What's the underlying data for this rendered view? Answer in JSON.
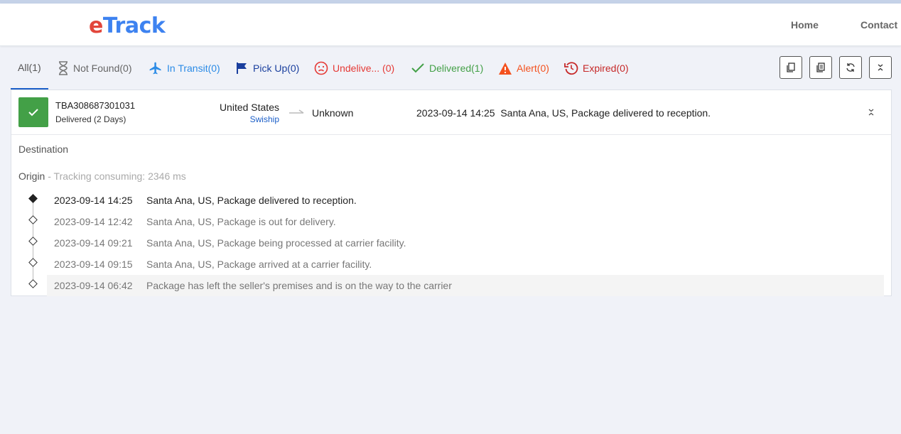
{
  "app": {
    "logo_e": "e",
    "logo_rest": "Track"
  },
  "nav": {
    "home": "Home",
    "contact": "Contact"
  },
  "tabs": [
    {
      "label": "All(1)",
      "icon": "none",
      "color": "#555555"
    },
    {
      "label": "Not Found(0)",
      "icon": "hourglass-icon",
      "color": "#666666"
    },
    {
      "label": "In Transit(0)",
      "icon": "airplane-icon",
      "color": "#2b8be6"
    },
    {
      "label": "Pick Up(0)",
      "icon": "flag-icon",
      "color": "#1a3f9e"
    },
    {
      "label": "Undelive... (0)",
      "icon": "sad-face-icon",
      "color": "#e53935"
    },
    {
      "label": "Delivered(1)",
      "icon": "check-icon",
      "color": "#43a047"
    },
    {
      "label": "Alert(0)",
      "icon": "warning-icon",
      "color": "#f4511e"
    },
    {
      "label": "Expired(0)",
      "icon": "history-icon",
      "color": "#c62828"
    }
  ],
  "toolbar": [
    "copy-icon",
    "copy-all-icon",
    "refresh-icon",
    "collapse-all-icon"
  ],
  "shipment": {
    "tracking_number": "TBA308687301031",
    "status": "Delivered (2 Days)",
    "origin_country": "United States",
    "carrier": "Swiship",
    "destination_country": "Unknown",
    "latest_time": "2023-09-14 14:25",
    "latest_desc": "Santa Ana, US, Package delivered to reception.",
    "status_color": "#43a047"
  },
  "details": {
    "destination_label": "Destination",
    "origin_label": "Origin",
    "origin_sub": " - Tracking consuming: 2346 ms"
  },
  "events": [
    {
      "time": "2023-09-14 14:25",
      "desc": "Santa Ana, US, Package delivered to reception."
    },
    {
      "time": "2023-09-14 12:42",
      "desc": "Santa Ana, US, Package is out for delivery."
    },
    {
      "time": "2023-09-14 09:21",
      "desc": "Santa Ana, US, Package being processed at carrier facility."
    },
    {
      "time": "2023-09-14 09:15",
      "desc": "Santa Ana, US, Package arrived at a carrier facility."
    },
    {
      "time": "2023-09-14 06:42",
      "desc": "Package has left the seller's premises and is on the way to the carrier"
    }
  ]
}
